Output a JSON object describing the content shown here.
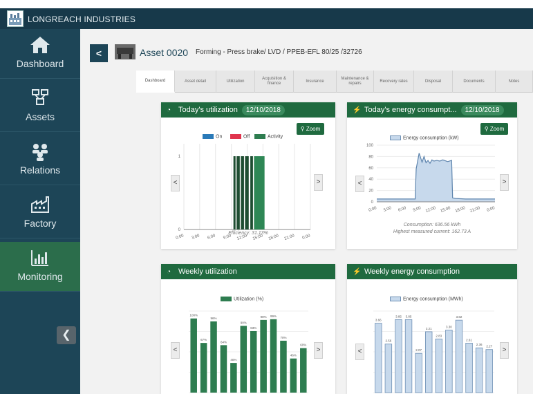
{
  "brand": {
    "name": "LONGREACH INDUSTRIES"
  },
  "sidebar": {
    "items": [
      {
        "label": "Dashboard",
        "icon": "home-icon"
      },
      {
        "label": "Assets",
        "icon": "assets-icon"
      },
      {
        "label": "Relations",
        "icon": "relations-icon"
      },
      {
        "label": "Factory",
        "icon": "factory-icon"
      },
      {
        "label": "Monitoring",
        "icon": "monitoring-icon"
      }
    ],
    "active": "Monitoring",
    "collapse_icon": "collapse-left-icon"
  },
  "header": {
    "asset_title": "Asset 0020",
    "asset_subtitle": "Forming - Press brake/ LVD / PPEB-EFL 80/25 /32726"
  },
  "tabs": [
    {
      "label": "Dashboard"
    },
    {
      "label": "Asset detail"
    },
    {
      "label": "Utilization"
    },
    {
      "label": "Acquisition & finance"
    },
    {
      "label": "Insurance"
    },
    {
      "label": "Maintenance & repairs"
    },
    {
      "label": "Recovery rates"
    },
    {
      "label": "Disposal"
    },
    {
      "label": "Documents"
    },
    {
      "label": "Notes"
    }
  ],
  "cards": {
    "util_today": {
      "title": "Today's utilization",
      "date": "12/10/2018",
      "zoom": "Zoom",
      "efficiency": "Efficiency: 31.13%"
    },
    "energy_today": {
      "title": "Today's energy consumpt...",
      "date": "12/10/2018",
      "zoom": "Zoom",
      "consumption": "Consumption: 636.56 kWh",
      "highest": "Highest measured current: 162.73 A"
    },
    "util_weekly": {
      "title": "Weekly utilization"
    },
    "energy_weekly": {
      "title": "Weekly energy consumption"
    }
  },
  "colors": {
    "green_dark": "#1f6a3f",
    "on": "#2a7ab8",
    "off": "#e0344d",
    "activity": "#2e7d50",
    "energy_fill": "#c7d9ec",
    "energy_line": "#6d8fb4"
  },
  "chart_data": [
    {
      "type": "bar",
      "title": "Today's utilization",
      "legend": [
        "On",
        "Off",
        "Activity"
      ],
      "x_ticks": [
        "0:00",
        "3:00",
        "6:00",
        "9:00",
        "12:00",
        "15:00",
        "18:00",
        "21:00",
        "0:00"
      ],
      "y_ticks": [
        "0",
        "1"
      ],
      "ylim": [
        0,
        1
      ],
      "activity_intervals_hours": [
        [
          9.4,
          9.8
        ],
        [
          10.0,
          10.6
        ],
        [
          10.8,
          11.4
        ],
        [
          11.6,
          12.3
        ],
        [
          12.6,
          13.1
        ],
        [
          13.3,
          15.3
        ]
      ]
    },
    {
      "type": "area",
      "title": "Energy consumption (kW)",
      "legend": [
        "Energy consumption (kW)"
      ],
      "x_ticks": [
        "0:00",
        "3:00",
        "6:00",
        "9:00",
        "12:00",
        "15:00",
        "18:00",
        "21:00",
        "0:00"
      ],
      "y_ticks": [
        "0",
        "20",
        "40",
        "60",
        "80",
        "100"
      ],
      "ylim": [
        0,
        100
      ],
      "x_hours": [
        0,
        2,
        4,
        6,
        7.8,
        8.0,
        8.6,
        9.2,
        9.6,
        10.0,
        10.4,
        10.8,
        11.2,
        11.6,
        12.2,
        12.8,
        13.4,
        14.4,
        15.2,
        15.4,
        16,
        18,
        20,
        22,
        24
      ],
      "values": [
        5,
        5,
        5,
        5,
        5,
        58,
        86,
        70,
        80,
        69,
        73,
        68,
        74,
        72,
        73,
        72,
        74,
        71,
        73,
        7,
        6,
        5,
        5,
        5,
        5
      ]
    },
    {
      "type": "bar",
      "title": "Weekly utilization",
      "legend": [
        "Utilization (%)"
      ],
      "data_labels": [
        "100%",
        "67%",
        "96%",
        "64%",
        "40%",
        "90%",
        "83%",
        "98%",
        "99%",
        "70%",
        "46%",
        "60%"
      ],
      "values": [
        100,
        67,
        96,
        64,
        40,
        90,
        83,
        98,
        99,
        70,
        46,
        60
      ],
      "ylim": [
        0,
        110
      ]
    },
    {
      "type": "bar",
      "title": "Weekly energy consumption",
      "legend": [
        "Energy consumption (MWh)"
      ],
      "data_labels": [
        "3.66",
        "2.56",
        "3.85",
        "3.85",
        "2.07",
        "3.21",
        "2.83",
        "3.30",
        "3.82",
        "2.61",
        "2.36",
        "2.27"
      ],
      "values": [
        3.66,
        2.56,
        3.85,
        3.85,
        2.07,
        3.21,
        2.83,
        3.3,
        3.82,
        2.61,
        2.36,
        2.27
      ],
      "ylim": [
        0,
        4.3
      ]
    }
  ]
}
